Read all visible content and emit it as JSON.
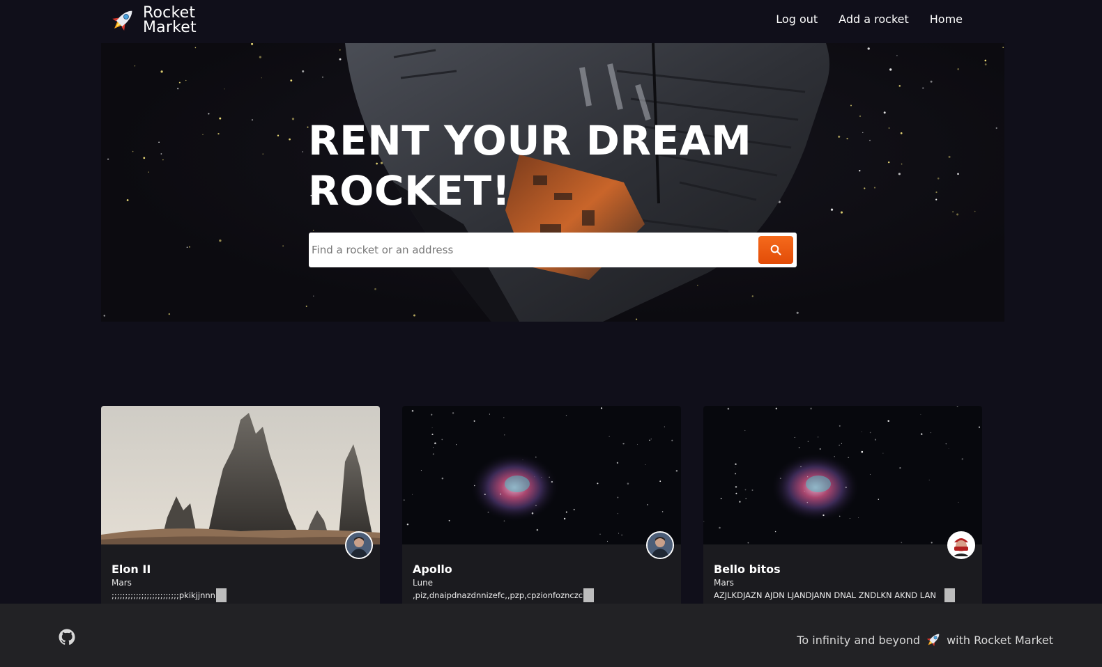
{
  "brand": {
    "line1": "Rocket",
    "line2": "Market",
    "icon": "rocket-icon"
  },
  "nav": {
    "items": [
      {
        "label": "Log out"
      },
      {
        "label": "Add a rocket"
      },
      {
        "label": "Home"
      }
    ]
  },
  "hero": {
    "title_line1": "RENT YOUR DREAM",
    "title_line2": "ROCKET!",
    "search_placeholder": "Find a rocket or an address",
    "search_icon": "search-icon"
  },
  "cards": [
    {
      "title": "Elon II",
      "location": "Mars",
      "description": ";;;;;;;;;;;;;;;;;;;;;;;;;pkikjjnnn"
    },
    {
      "title": "Apollo",
      "location": "Lune",
      "description": ",piz,dnaipdnazdnnizefc,,pzp,cpzionfoznczc"
    },
    {
      "title": "Bello bitos",
      "location": "Mars",
      "description": "AZJLKDJAZN AJDN LJANDJANN DNAL ZNDLKN AKND LAN"
    }
  ],
  "footer": {
    "text_before": "To infinity and beyond",
    "text_after": "with Rocket Market",
    "github_icon": "github-icon"
  },
  "colors": {
    "accent": "#f26419",
    "background": "#100f1a",
    "card": "#1b1b1f",
    "footer": "#222225"
  }
}
